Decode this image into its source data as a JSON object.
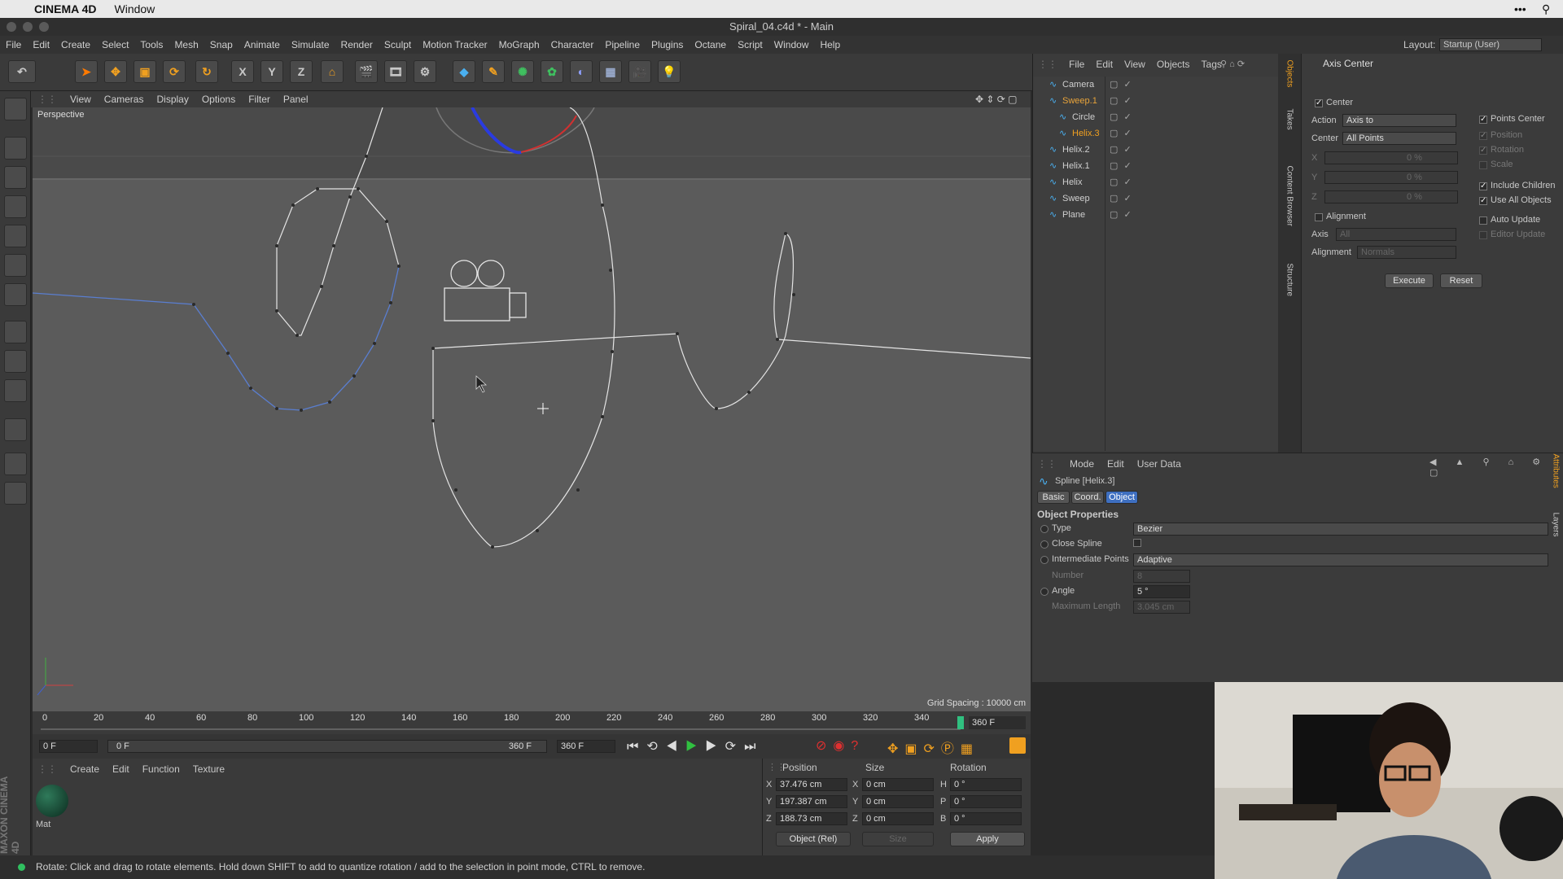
{
  "macbar": {
    "apple": "",
    "app": "CINEMA 4D",
    "window": "Window"
  },
  "title": "Spiral_04.c4d * - Main",
  "menu": [
    "File",
    "Edit",
    "Create",
    "Select",
    "Tools",
    "Mesh",
    "Snap",
    "Animate",
    "Simulate",
    "Render",
    "Sculpt",
    "Motion Tracker",
    "MoGraph",
    "Character",
    "Pipeline",
    "Plugins",
    "Octane",
    "Script",
    "Window",
    "Help"
  ],
  "layout": {
    "label": "Layout:",
    "value": "Startup (User)"
  },
  "axis_buttons": [
    "X",
    "Y",
    "Z"
  ],
  "viewport": {
    "menu": [
      "View",
      "Cameras",
      "Display",
      "Options",
      "Filter",
      "Panel"
    ],
    "label": "Perspective",
    "grid": "Grid Spacing : 10000 cm"
  },
  "timeline": {
    "ticks": [
      "0",
      "20",
      "40",
      "60",
      "80",
      "100",
      "120",
      "140",
      "160",
      "180",
      "200",
      "220",
      "240",
      "260",
      "280",
      "300",
      "320",
      "340"
    ],
    "end": "360 F",
    "start_frame": "0 F",
    "range_start": "0 F",
    "range_end": "360 F",
    "max": "360 F"
  },
  "materials": {
    "menu": [
      "Create",
      "Edit",
      "Function",
      "Texture"
    ],
    "mat": "Mat"
  },
  "coords": {
    "headers": [
      "Position",
      "Size",
      "Rotation"
    ],
    "rows": [
      {
        "a": "X",
        "p": "37.476 cm",
        "s": "X",
        "sv": "0 cm",
        "r": "H",
        "rv": "0 °"
      },
      {
        "a": "Y",
        "p": "197.387 cm",
        "s": "Y",
        "sv": "0 cm",
        "r": "P",
        "rv": "0 °"
      },
      {
        "a": "Z",
        "p": "188.73 cm",
        "s": "Z",
        "sv": "0 cm",
        "r": "B",
        "rv": "0 °"
      }
    ],
    "mode": "Object (Rel)",
    "size": "Size",
    "apply": "Apply"
  },
  "status": "Rotate: Click and drag to rotate elements. Hold down SHIFT to add to quantize rotation / add to the selection in point mode, CTRL to remove.",
  "objects": {
    "menu": [
      "File",
      "Edit",
      "View",
      "Objects",
      "Tags"
    ],
    "items": [
      {
        "name": "Camera",
        "indent": 0,
        "color": "#cfcfcf"
      },
      {
        "name": "Sweep.1",
        "indent": 0,
        "color": "#e8a33a"
      },
      {
        "name": "Circle",
        "indent": 1,
        "color": "#cfcfcf"
      },
      {
        "name": "Helix.3",
        "indent": 1,
        "color": "#f0a020"
      },
      {
        "name": "Helix.2",
        "indent": 0,
        "color": "#cfcfcf"
      },
      {
        "name": "Helix.1",
        "indent": 0,
        "color": "#cfcfcf"
      },
      {
        "name": "Helix",
        "indent": 0,
        "color": "#cfcfcf"
      },
      {
        "name": "Sweep",
        "indent": 0,
        "color": "#cfcfcf"
      },
      {
        "name": "Plane",
        "indent": 0,
        "color": "#cfcfcf"
      }
    ]
  },
  "sidetabs": [
    "Objects",
    "Takes",
    "Content Browser",
    "Structure"
  ],
  "tool": {
    "title": "Axis Center",
    "center": "Center",
    "action_label": "Action",
    "action": "Axis to",
    "center_label": "Center",
    "center_val": "All Points",
    "x": "X",
    "y": "Y",
    "z": "Z",
    "pct": "0 %",
    "right": [
      "Points Center",
      "Position",
      "Rotation",
      "Scale",
      "Include Children",
      "Use All Objects",
      "Auto Update",
      "Editor Update"
    ],
    "alignment": "Alignment",
    "axis_label": "Axis",
    "axis_val": "All",
    "align_label": "Alignment",
    "align_val": "Normals",
    "execute": "Execute",
    "reset": "Reset"
  },
  "attr": {
    "menu": [
      "Mode",
      "Edit",
      "User Data"
    ],
    "object": "Spline [Helix.3]",
    "tabs": [
      "Basic",
      "Coord.",
      "Object"
    ],
    "section": "Object Properties",
    "props": [
      {
        "label": "Type",
        "value": "Bezier"
      },
      {
        "label": "Close Spline",
        "value": ""
      },
      {
        "label": "Intermediate Points",
        "value": "Adaptive"
      },
      {
        "label": "Number",
        "value": "8"
      },
      {
        "label": "Angle",
        "value": "5 °"
      },
      {
        "label": "Maximum Length",
        "value": "3.045 cm"
      }
    ]
  },
  "righttabs": [
    "Attributes",
    "Layers"
  ],
  "brand": "MAXON CINEMA 4D"
}
